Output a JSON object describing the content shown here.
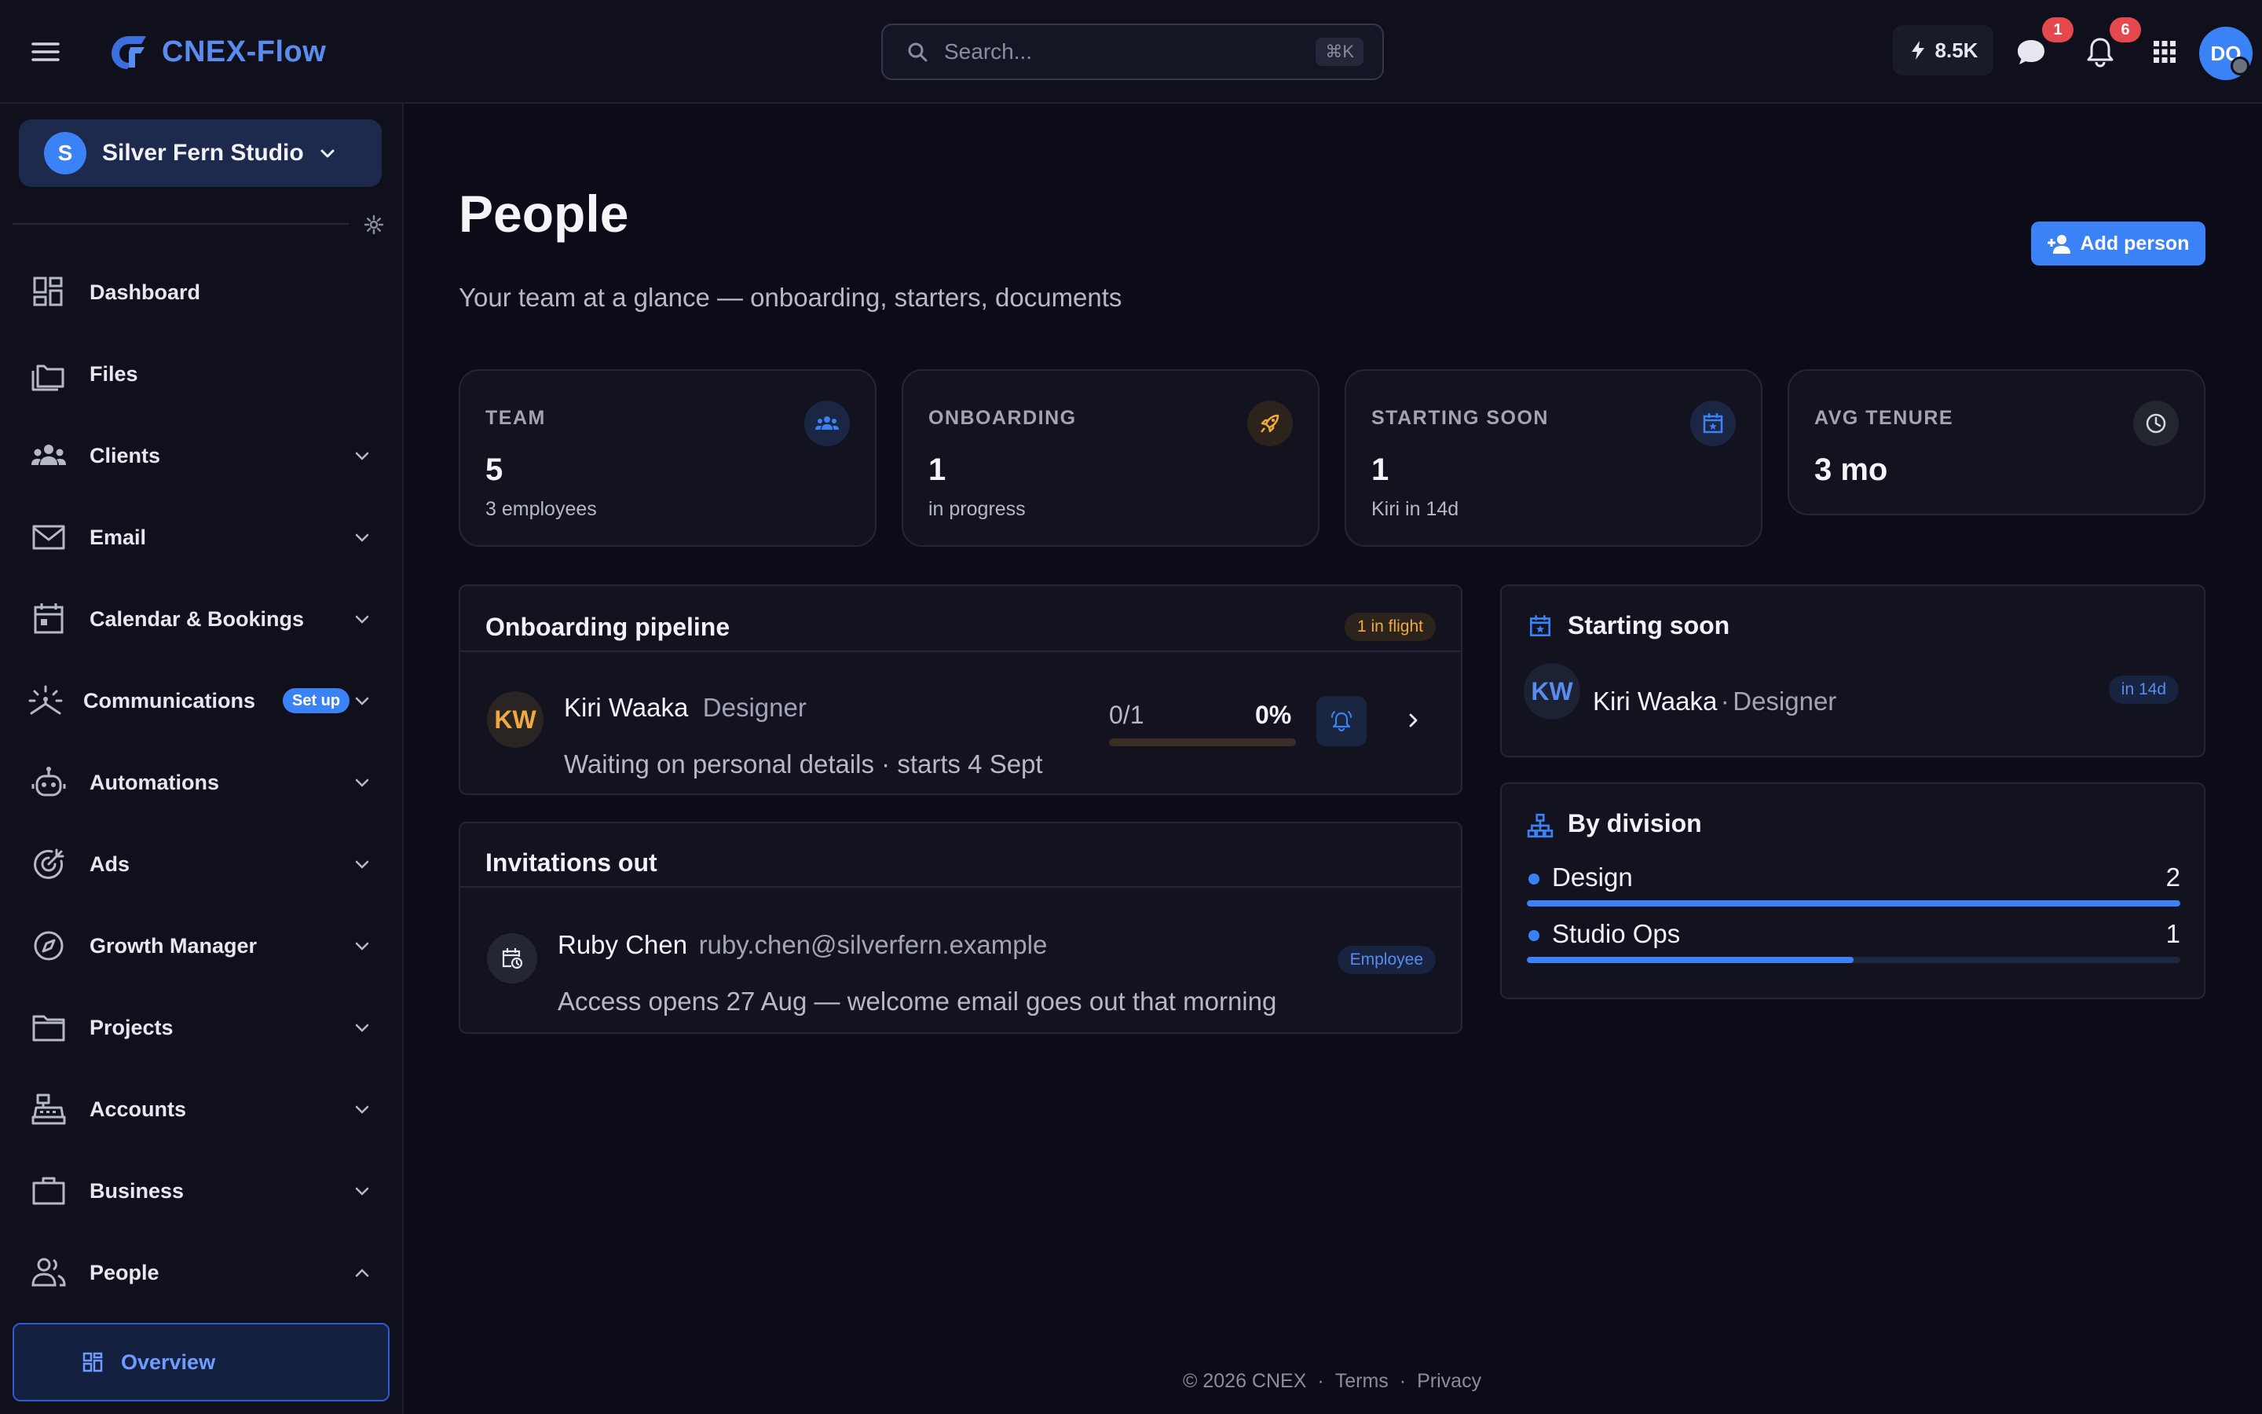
{
  "app": {
    "name": "CNEX-Flow"
  },
  "search": {
    "placeholder": "Search...",
    "shortcut": "⌘K"
  },
  "header": {
    "credits": "8.5K",
    "messages_count": "1",
    "notifications_count": "6",
    "user_initials": "DO"
  },
  "workspace": {
    "initial": "S",
    "name": "Silver Fern Studio"
  },
  "sidebar": {
    "items": [
      {
        "label": "Dashboard",
        "icon": "dashboard-icon"
      },
      {
        "label": "Files",
        "icon": "files-icon"
      },
      {
        "label": "Clients",
        "icon": "clients-icon"
      },
      {
        "label": "Email",
        "icon": "email-icon"
      },
      {
        "label": "Calendar & Bookings",
        "icon": "calendar-icon"
      },
      {
        "label": "Communications",
        "icon": "communications-icon",
        "badge": "Set up"
      },
      {
        "label": "Automations",
        "icon": "robot-icon"
      },
      {
        "label": "Ads",
        "icon": "target-icon"
      },
      {
        "label": "Growth Manager",
        "icon": "compass-icon"
      },
      {
        "label": "Projects",
        "icon": "folder-icon"
      },
      {
        "label": "Accounts",
        "icon": "cash-register-icon"
      },
      {
        "label": "Business",
        "icon": "briefcase-icon"
      },
      {
        "label": "People",
        "icon": "people-icon"
      }
    ],
    "active_sub": "Overview"
  },
  "page": {
    "title": "People",
    "subtitle": "Your team at a glance — onboarding, starters, documents",
    "add_button": "Add person"
  },
  "stats": [
    {
      "label": "TEAM",
      "value": "5",
      "sub": "3 employees",
      "icon": "team-icon"
    },
    {
      "label": "ONBOARDING",
      "value": "1",
      "sub": "in progress",
      "icon": "rocket-icon"
    },
    {
      "label": "STARTING SOON",
      "value": "1",
      "sub": "Kiri in 14d",
      "icon": "calendar-star-icon"
    },
    {
      "label": "AVG TENURE",
      "value": "3 mo",
      "sub": "",
      "icon": "clock-icon"
    }
  ],
  "pipeline": {
    "title": "Onboarding pipeline",
    "badge": "1 in flight",
    "row": {
      "initials": "KW",
      "name": "Kiri Waaka",
      "role": "Designer",
      "meta": "Waiting on personal details · starts 4 Sept",
      "count": "0/1",
      "percent": "0%",
      "progress": 0
    }
  },
  "invitations": {
    "title": "Invitations out",
    "row": {
      "name": "Ruby Chen",
      "email": "ruby.chen@silverfern.example",
      "meta": "Access opens 27 Aug — welcome email goes out that morning",
      "role": "Employee"
    }
  },
  "starting_soon": {
    "title": "Starting soon",
    "initials": "KW",
    "name": "Kiri Waaka",
    "separator": "·",
    "role": "Designer",
    "when": "in 14d"
  },
  "divisions": {
    "title": "By division",
    "items": [
      {
        "name": "Design",
        "count": "2",
        "fraction": 1.0
      },
      {
        "name": "Studio Ops",
        "count": "1",
        "fraction": 0.5
      }
    ]
  },
  "footer": {
    "copyright": "© 2026 CNEX",
    "sep": "·",
    "terms": "Terms",
    "privacy": "Privacy"
  },
  "colors": {
    "accent": "#3b82f6",
    "warning": "#f0a93e",
    "danger": "#e5484d",
    "background": "#0b0c17"
  }
}
